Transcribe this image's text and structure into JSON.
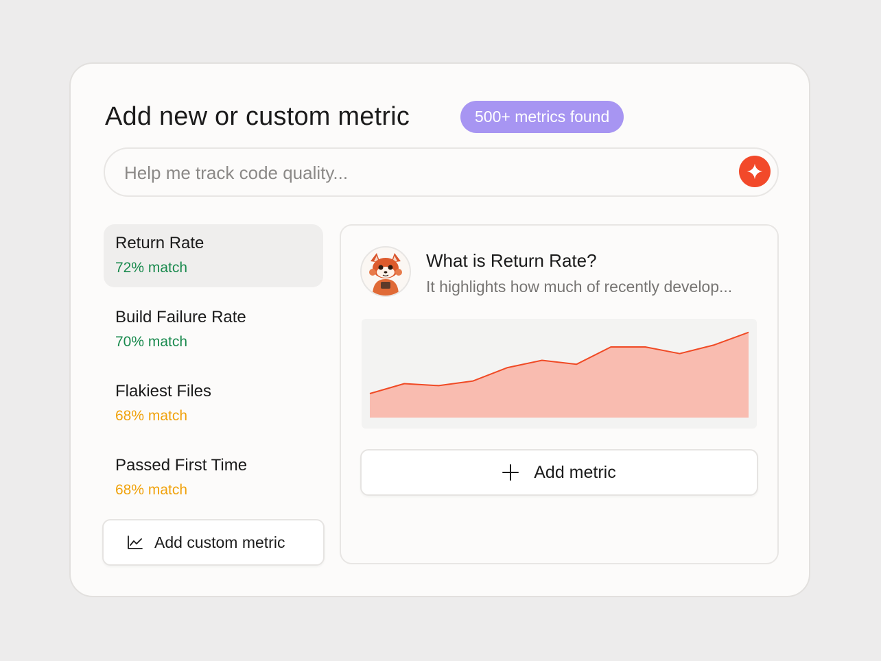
{
  "header": {
    "title": "Add new or custom metric",
    "badge": "500+ metrics found"
  },
  "search": {
    "placeholder": "Help me track code quality...",
    "value": "",
    "ai_button_icon": "sparkle-icon"
  },
  "metrics": [
    {
      "name": "Return Rate",
      "match": "72% match",
      "match_color": "#1a8a4e",
      "selected": true
    },
    {
      "name": "Build Failure Rate",
      "match": "70% match",
      "match_color": "#1a8a4e",
      "selected": false
    },
    {
      "name": "Flakiest Files",
      "match": "68% match",
      "match_color": "#f0a20c",
      "selected": false
    },
    {
      "name": "Passed First Time",
      "match": "68% match",
      "match_color": "#f0a20c",
      "selected": false
    }
  ],
  "add_custom": {
    "label": "Add custom metric",
    "icon": "line-chart-icon"
  },
  "detail": {
    "title": "What is Return Rate?",
    "description": "It highlights how much of recently develop...",
    "avatar": "red-panda-avatar",
    "add_button": {
      "label": "Add metric",
      "icon": "plus-icon"
    }
  },
  "chart_data": {
    "type": "area",
    "title": "",
    "xlabel": "",
    "ylabel": "",
    "x": [
      1,
      2,
      3,
      4,
      5,
      6,
      7,
      8,
      9,
      10,
      11,
      12
    ],
    "values": [
      36,
      51,
      48,
      55,
      75,
      86,
      80,
      106,
      106,
      96,
      109,
      128
    ],
    "ylim": [
      0,
      140
    ],
    "grid": false,
    "colors": {
      "line": "#f04a25",
      "fill": "#f9bcb0",
      "background": "#f3f3f2"
    }
  },
  "colors": {
    "accent": "#f2492a",
    "badge": "#a795f2",
    "match_high": "#1a8a4e",
    "match_mid": "#f0a20c"
  }
}
